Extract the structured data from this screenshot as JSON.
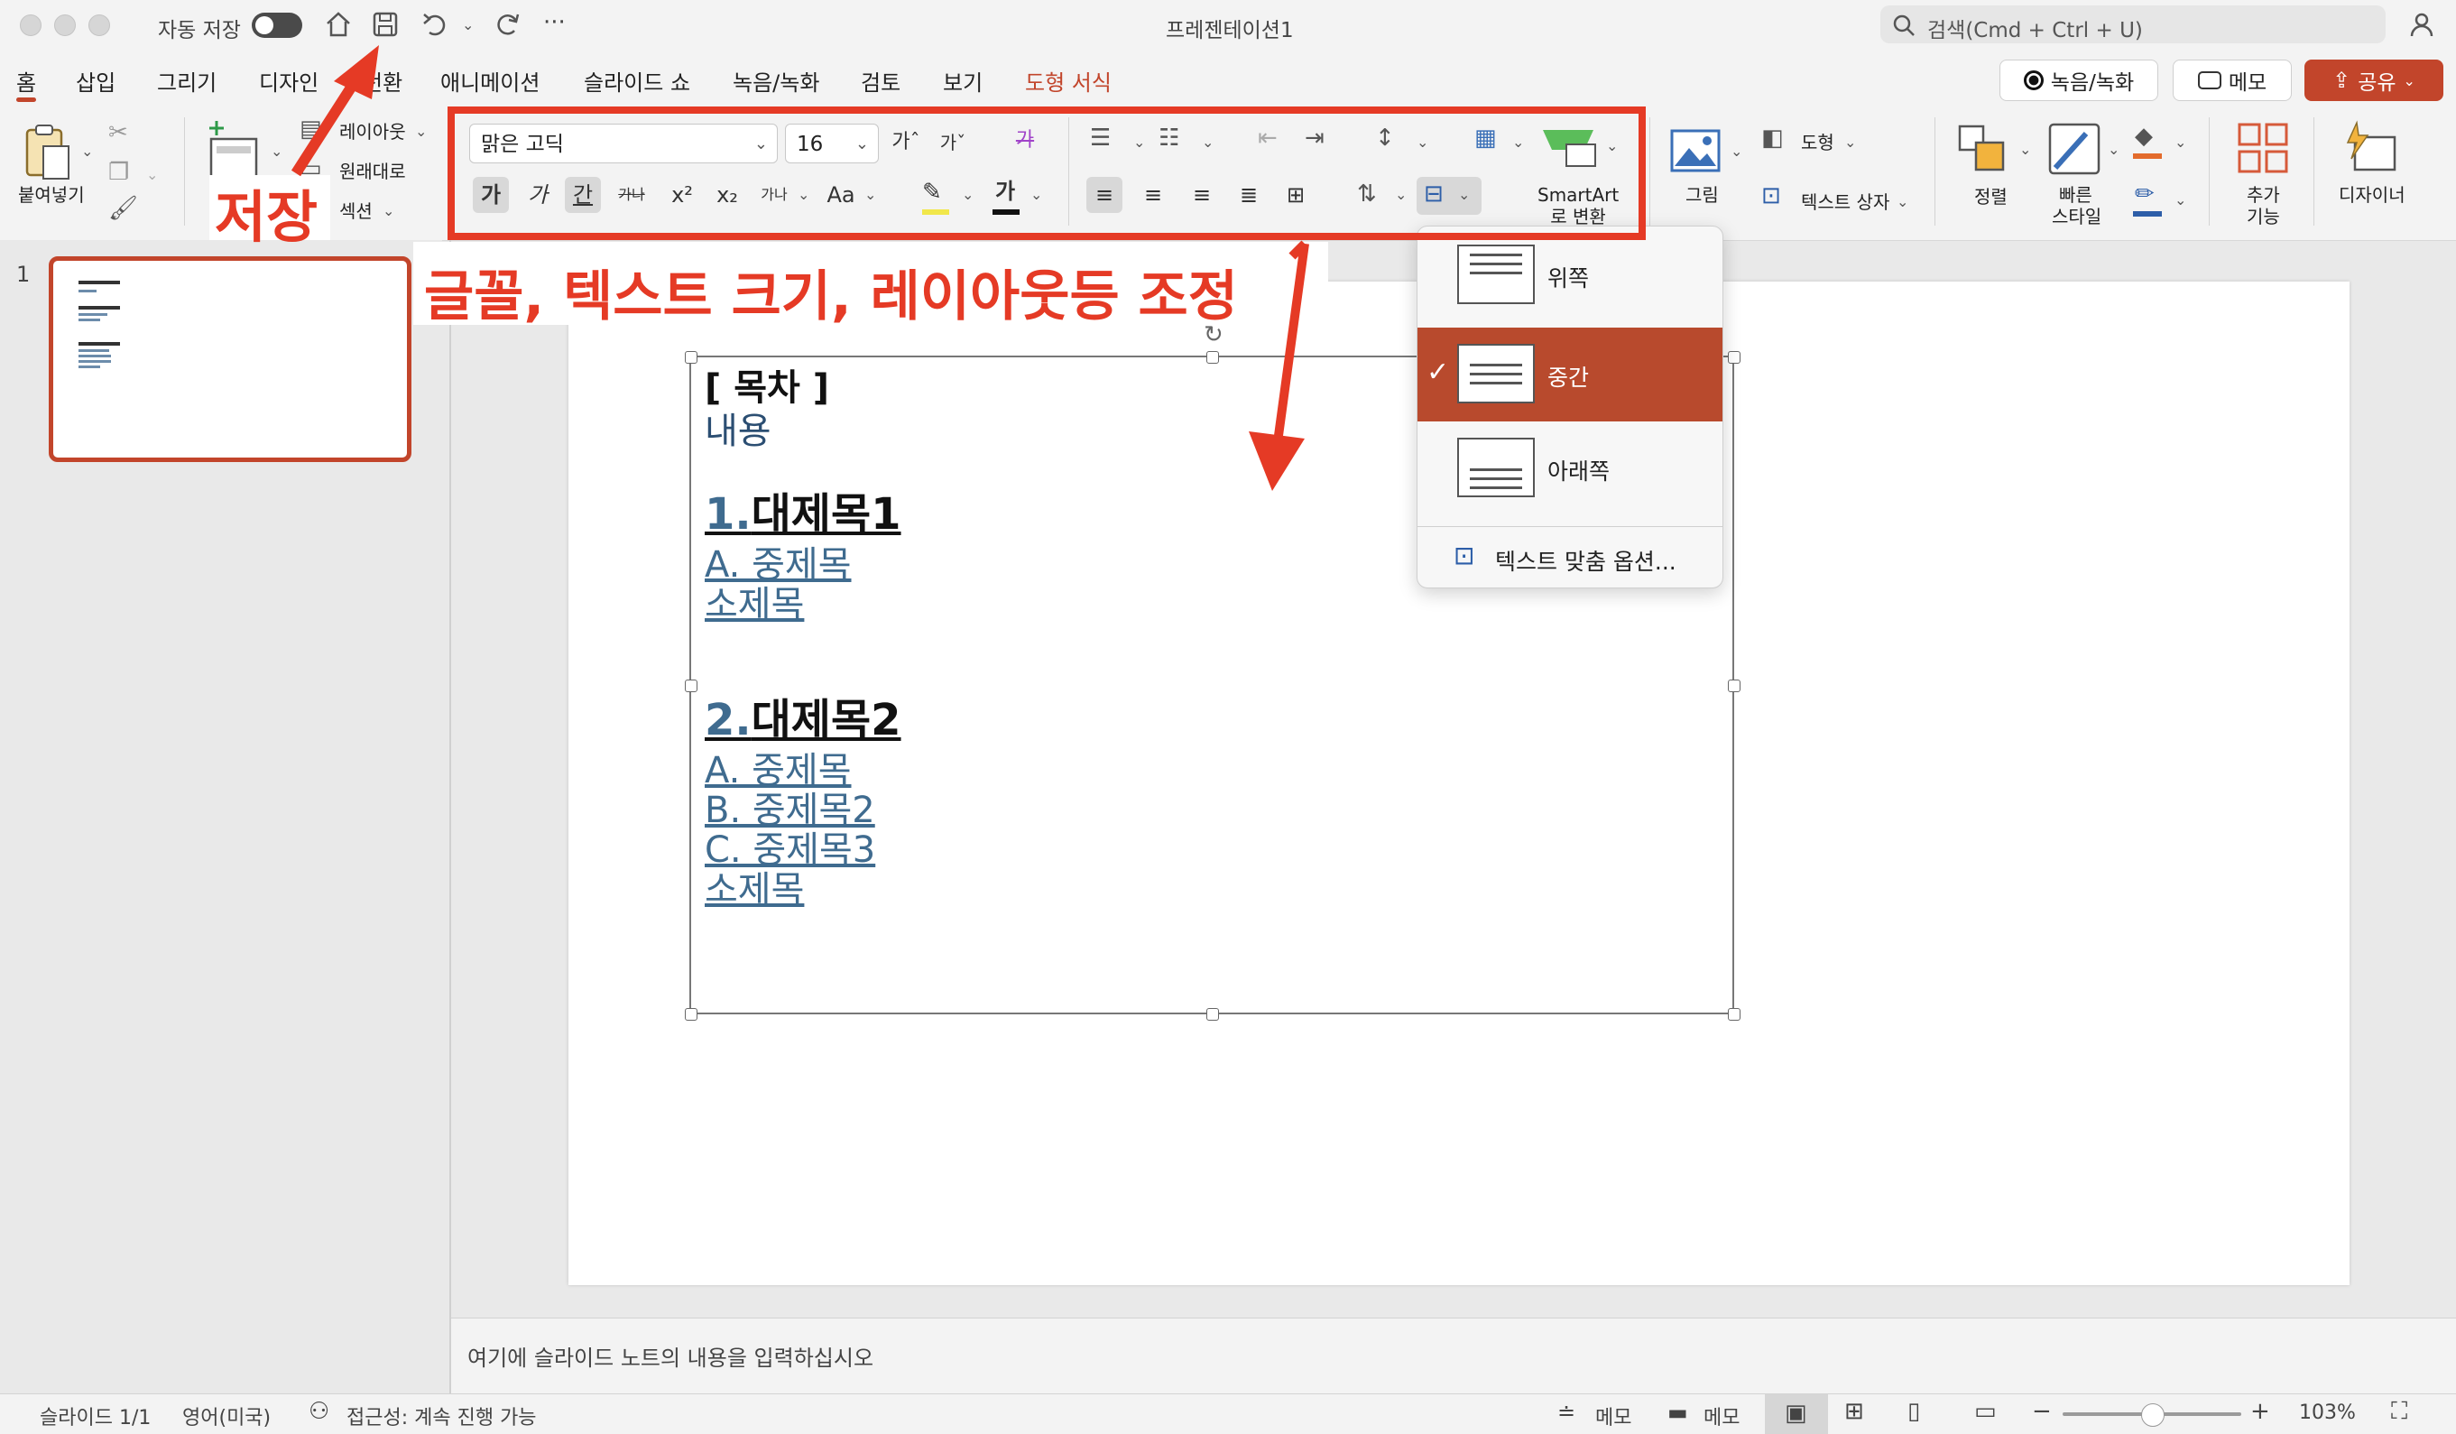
{
  "titlebar": {
    "autosave_label": "자동 저장",
    "title": "프레젠테이션1",
    "search_placeholder": "검색(Cmd + Ctrl + U)",
    "more_label": "···"
  },
  "tabs": [
    {
      "label": "홈"
    },
    {
      "label": "삽입"
    },
    {
      "label": "그리기"
    },
    {
      "label": "디자인"
    },
    {
      "label": "전환"
    },
    {
      "label": "애니메이션"
    },
    {
      "label": "슬라이드 쇼"
    },
    {
      "label": "녹음/녹화"
    },
    {
      "label": "검토"
    },
    {
      "label": "보기"
    },
    {
      "label": "도형 서식"
    }
  ],
  "right_buttons": {
    "record": "녹음/녹화",
    "memo": "메모",
    "share": "공유"
  },
  "ribbon": {
    "paste": "붙여넣기",
    "layout": "레이아웃",
    "reset": "원래대로",
    "section": "섹션",
    "font_name": "맑은 고딕",
    "font_size": "16",
    "smartart": "SmartArt",
    "smartart2": "로 변환",
    "picture": "그림",
    "shape": "도형",
    "textbox": "텍스트 상자",
    "arrange": "정렬",
    "quick_style1": "빠른",
    "quick_style2": "스타일",
    "addins1": "추가",
    "addins2": "기능",
    "designer": "디자이너",
    "bold_glyph": "가",
    "italic_glyph": "가",
    "underline_glyph": "간",
    "strike_glyph": "가나",
    "super_glyph": "x²",
    "sub_glyph": "x₂",
    "spacing_glyph": "가나",
    "case_glyph": "Aa",
    "grow_glyph": "가ˆ",
    "shrink_glyph": "가ˇ",
    "clear_glyph": "가",
    "fontcolor_glyph": "가"
  },
  "slide_panel": {
    "slide_number": "1"
  },
  "slide_content": {
    "toc_title": "[ 목차 ]",
    "content_label": "내용",
    "h1_num": "1.",
    "h1_text": "대제목1",
    "h1_a": "A. 중제목",
    "h1_small": "소제목",
    "h2_num": "2.",
    "h2_text": "대제목2",
    "h2_a": "A. 중제목",
    "h2_b": "B. 중제목2",
    "h2_c": "C. 중제목3",
    "h2_small": "소제목"
  },
  "dropdown": {
    "items": [
      {
        "label": "위쪽",
        "selected": false
      },
      {
        "label": "중간",
        "selected": true
      },
      {
        "label": "아래쪽",
        "selected": false
      }
    ],
    "options_label": "텍스트 맞춤 옵션...",
    "check": "✓"
  },
  "notes": {
    "placeholder": "여기에 슬라이드 노트의 내용을 입력하십시오"
  },
  "statusbar": {
    "slide_count": "슬라이드 1/1",
    "language": "영어(미국)",
    "accessibility": "접근성: 계속 진행 가능",
    "notes_btn": "메모",
    "comments_btn": "메모",
    "zoom_minus": "−",
    "zoom_plus": "+",
    "zoom_level": "103%",
    "zoom_fraction": 0.5
  },
  "annotations": {
    "save_label": "저장",
    "font_label": "글꼴, 텍스트 크기, 레이아웃등 조정",
    "color": "#e53a25"
  },
  "colors": {
    "accent": "#c2452b",
    "annotation": "#e53a25",
    "link": "#3f6b8f"
  }
}
